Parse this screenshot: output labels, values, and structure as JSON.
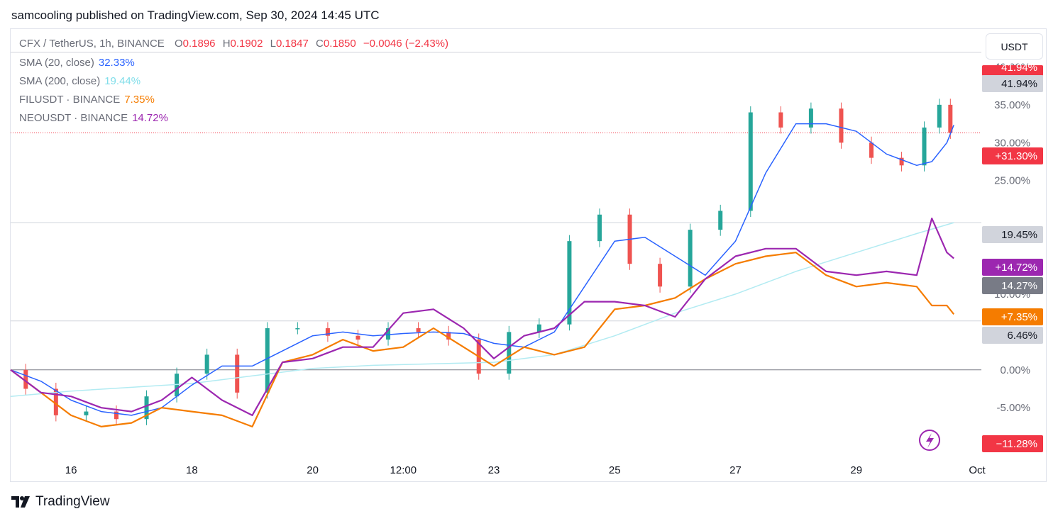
{
  "header": {
    "text": "samcooling published on TradingView.com, Sep 30, 2024 14:45 UTC"
  },
  "legend": {
    "symbol": "CFX / TetherUS, 1h, BINANCE",
    "o_label": "O",
    "o": "0.1896",
    "h_label": "H",
    "h": "0.1902",
    "l_label": "L",
    "l": "0.1847",
    "c_label": "C",
    "c": "0.1850",
    "change": "−0.0046 (−2.43%)",
    "sma20_label": "SMA (20, close)",
    "sma20_value": "32.33%",
    "sma200_label": "SMA (200, close)",
    "sma200_value": "19.44%",
    "fil_label": "FILUSDT · BINANCE",
    "fil_value": "7.35%",
    "neo_label": "NEOUSDT · BINANCE",
    "neo_value": "14.72%"
  },
  "currency_button": "USDT",
  "footer": {
    "brand": "TradingView"
  },
  "colors": {
    "up": "#26a69a",
    "down": "#ef5350",
    "sma20": "#2962ff",
    "sma200": "#b2ebf2",
    "fil": "#f57c00",
    "neo": "#9c27b0",
    "red_badge": "#f23645",
    "grey_badge": "#d1d4dc",
    "dark_badge": "#787b86"
  },
  "chart_data": {
    "type": "line",
    "scale": "percent",
    "y_axis_ticks": [
      "40.00%",
      "35.00%",
      "30.00%",
      "25.00%",
      "10.00%",
      "0.00%",
      "-5.00%",
      "-10.00%"
    ],
    "y_range": [
      -12,
      45
    ],
    "x_axis_ticks": [
      "16",
      "18",
      "20",
      "12:00",
      "23",
      "25",
      "27",
      "29",
      "Oct"
    ],
    "x_range": [
      "2024-09-15 00:00",
      "2024-10-01 00:00"
    ],
    "price_labels": [
      {
        "text": "41.94%",
        "kind": "red",
        "value": 41.94
      },
      {
        "text": "41.94%",
        "kind": "grey",
        "value": 41.94
      },
      {
        "text": "+31.30%",
        "kind": "red",
        "value": 31.3
      },
      {
        "text": "19.45%",
        "kind": "grey",
        "value": 19.45
      },
      {
        "text": "+14.72%",
        "kind": "neo",
        "value": 14.72
      },
      {
        "text": "14.27%",
        "kind": "dark",
        "value": 14.27
      },
      {
        "text": "+7.35%",
        "kind": "fil",
        "value": 7.35
      },
      {
        "text": "6.46%",
        "kind": "grey",
        "value": 6.46
      },
      {
        "text": "−11.28%",
        "kind": "red",
        "value": -11.28
      }
    ],
    "horizontal_lines": [
      41.94,
      19.45,
      6.46,
      0
    ],
    "current_line": 31.3,
    "series": [
      {
        "name": "CFX / TetherUS",
        "style": "candles",
        "color_key": "up",
        "x": [
          "09-15 00:00",
          "09-15 12:00",
          "09-16 00:00",
          "09-16 12:00",
          "09-17 00:00",
          "09-17 12:00",
          "09-18 00:00",
          "09-18 12:00",
          "09-19 00:00",
          "09-19 12:00",
          "09-20 00:00",
          "09-20 12:00",
          "09-21 00:00",
          "09-21 12:00",
          "09-22 00:00",
          "09-22 12:00",
          "09-23 00:00",
          "09-23 12:00",
          "09-24 00:00",
          "09-24 12:00",
          "09-25 00:00",
          "09-25 12:00",
          "09-26 00:00",
          "09-26 12:00",
          "09-27 00:00",
          "09-27 12:00",
          "09-28 00:00",
          "09-28 12:00",
          "09-29 00:00",
          "09-29 12:00",
          "09-30 00:00",
          "09-30 06:00",
          "09-30 12:00",
          "09-30 14:45"
        ],
        "values": [
          0,
          -2.5,
          -6,
          -5.5,
          -6.5,
          -3.5,
          -0.5,
          2,
          -3,
          5.5,
          5.5,
          4.5,
          4,
          5.5,
          5,
          4,
          -0.5,
          5,
          6,
          17,
          20.5,
          14,
          11,
          18.5,
          21,
          34,
          32,
          34.5,
          30,
          28,
          27,
          32,
          35,
          31.3
        ]
      },
      {
        "name": "SMA (20, close)",
        "color_key": "sma20",
        "x": [
          "09-15 00:00",
          "09-15 12:00",
          "09-16 00:00",
          "09-16 12:00",
          "09-17 00:00",
          "09-17 12:00",
          "09-18 00:00",
          "09-18 12:00",
          "09-19 00:00",
          "09-19 12:00",
          "09-20 00:00",
          "09-20 12:00",
          "09-21 00:00",
          "09-21 12:00",
          "09-22 00:00",
          "09-22 12:00",
          "09-23 00:00",
          "09-23 12:00",
          "09-24 00:00",
          "09-24 12:00",
          "09-25 00:00",
          "09-25 12:00",
          "09-26 00:00",
          "09-26 12:00",
          "09-27 00:00",
          "09-27 12:00",
          "09-28 00:00",
          "09-28 12:00",
          "09-29 00:00",
          "09-29 12:00",
          "09-30 00:00",
          "09-30 06:00",
          "09-30 12:00",
          "09-30 14:45"
        ],
        "values": [
          0,
          -1.5,
          -4,
          -5.5,
          -6,
          -5,
          -2,
          0.5,
          0.5,
          2.5,
          4.5,
          5,
          4.5,
          4.8,
          5,
          4.8,
          3.5,
          3,
          5,
          11,
          17,
          17.5,
          15,
          12.5,
          17,
          26,
          32.5,
          32.5,
          31.5,
          28.5,
          27,
          27.5,
          30,
          32.33
        ]
      },
      {
        "name": "SMA (200, close)",
        "color_key": "sma200",
        "x": [
          "09-15 00:00",
          "09-16 00:00",
          "09-17 00:00",
          "09-18 00:00",
          "09-19 00:00",
          "09-20 00:00",
          "09-21 00:00",
          "09-22 00:00",
          "09-23 00:00",
          "09-24 00:00",
          "09-25 00:00",
          "09-26 00:00",
          "09-27 00:00",
          "09-28 00:00",
          "09-29 00:00",
          "09-30 00:00",
          "09-30 14:45"
        ],
        "values": [
          -3.5,
          -2.8,
          -2.3,
          -1.8,
          -0.8,
          0.2,
          0.6,
          0.8,
          1.0,
          2.0,
          4.5,
          7.5,
          10,
          13,
          15.5,
          18,
          19.44
        ]
      },
      {
        "name": "FILUSDT · BINANCE",
        "color_key": "fil",
        "x": [
          "09-15 00:00",
          "09-15 12:00",
          "09-16 00:00",
          "09-16 12:00",
          "09-17 00:00",
          "09-17 12:00",
          "09-18 00:00",
          "09-18 12:00",
          "09-19 00:00",
          "09-19 12:00",
          "09-20 00:00",
          "09-20 12:00",
          "09-21 00:00",
          "09-21 12:00",
          "09-22 00:00",
          "09-22 12:00",
          "09-23 00:00",
          "09-23 12:00",
          "09-24 00:00",
          "09-24 12:00",
          "09-25 00:00",
          "09-25 12:00",
          "09-26 00:00",
          "09-26 12:00",
          "09-27 00:00",
          "09-27 12:00",
          "09-28 00:00",
          "09-28 12:00",
          "09-29 00:00",
          "09-29 12:00",
          "09-30 00:00",
          "09-30 06:00",
          "09-30 12:00",
          "09-30 14:45"
        ],
        "values": [
          0,
          -3,
          -6,
          -7.5,
          -7,
          -5,
          -5.5,
          -6,
          -7.5,
          1,
          2,
          4,
          2.5,
          3,
          5.5,
          3,
          0.5,
          3,
          2,
          3,
          8,
          8.5,
          9.5,
          12,
          14,
          15,
          15.5,
          12.5,
          11,
          11.5,
          11,
          8.5,
          8.5,
          7.35
        ]
      },
      {
        "name": "NEOUSDT · BINANCE",
        "color_key": "neo",
        "x": [
          "09-15 00:00",
          "09-15 12:00",
          "09-16 00:00",
          "09-16 12:00",
          "09-17 00:00",
          "09-17 12:00",
          "09-18 00:00",
          "09-18 12:00",
          "09-19 00:00",
          "09-19 12:00",
          "09-20 00:00",
          "09-20 12:00",
          "09-21 00:00",
          "09-21 12:00",
          "09-22 00:00",
          "09-22 12:00",
          "09-23 00:00",
          "09-23 12:00",
          "09-24 00:00",
          "09-24 12:00",
          "09-25 00:00",
          "09-25 12:00",
          "09-26 00:00",
          "09-26 12:00",
          "09-27 00:00",
          "09-27 12:00",
          "09-28 00:00",
          "09-28 12:00",
          "09-29 00:00",
          "09-29 12:00",
          "09-30 00:00",
          "09-30 06:00",
          "09-30 12:00",
          "09-30 14:45"
        ],
        "values": [
          0,
          -3,
          -3.5,
          -5,
          -5.5,
          -4,
          -1,
          -4,
          -6,
          1,
          1.5,
          3,
          3,
          7.5,
          8,
          5.5,
          1.5,
          4.5,
          5.5,
          9,
          9,
          8.5,
          7,
          12,
          15,
          16,
          16,
          13,
          12.5,
          13,
          12.5,
          20,
          15.5,
          14.72
        ]
      }
    ]
  }
}
